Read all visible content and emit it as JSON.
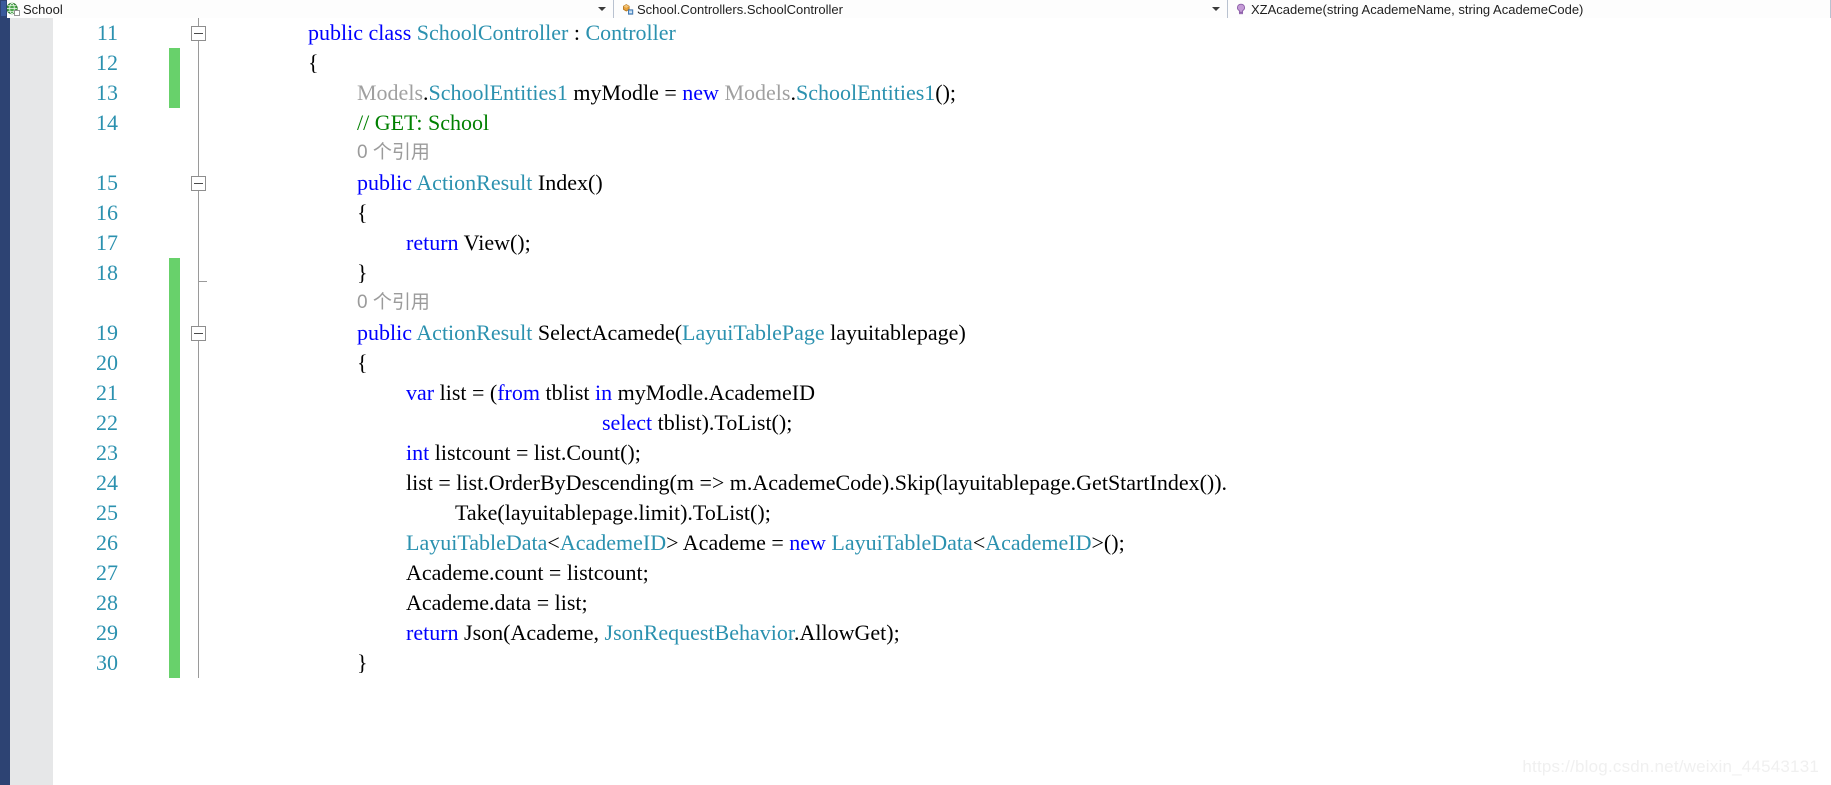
{
  "nav": {
    "project": {
      "label": "School",
      "icon": "globe-icon"
    },
    "type": {
      "label": "School.Controllers.SchoolController",
      "icon": "class-icon"
    },
    "member": {
      "label": "XZAcademe(string AcademeName, string AcademeCode)",
      "icon": "method-icon"
    },
    "dropdown_arrow": "chevron-down-icon"
  },
  "editor": {
    "first_line_number": 11,
    "last_line_number": 30,
    "line_numbers": [
      "11",
      "12",
      "13",
      "14",
      "",
      "15",
      "16",
      "17",
      "18",
      "",
      "19",
      "20",
      "21",
      "22",
      "23",
      "24",
      "25",
      "26",
      "27",
      "28",
      "29",
      "30"
    ],
    "change_bar_color": "#68d16b",
    "line_number_color": "#2b91af",
    "colors": {
      "keyword": "#0000ff",
      "type": "#2b91af",
      "comment": "#008000",
      "codelens": "#9b9b9b",
      "plain": "#000000",
      "dimmed": "#a0a0a0",
      "background": "#ffffff",
      "glyph_margin": "#e6e7e8",
      "selection_margin": "#2d4373"
    },
    "lines": [
      {
        "n": "11",
        "indent": 2,
        "change": false,
        "outline": "collapse",
        "tokens": [
          {
            "t": "public",
            "c": "kw"
          },
          {
            "t": " ",
            "c": "plain"
          },
          {
            "t": "class",
            "c": "kw"
          },
          {
            "t": " ",
            "c": "plain"
          },
          {
            "t": "SchoolController",
            "c": "typ"
          },
          {
            "t": " : ",
            "c": "plain"
          },
          {
            "t": "Controller",
            "c": "typ"
          }
        ]
      },
      {
        "n": "12",
        "indent": 2,
        "change": true,
        "outline": "line",
        "tokens": [
          {
            "t": "{",
            "c": "plain"
          }
        ]
      },
      {
        "n": "13",
        "indent": 3,
        "change": true,
        "outline": "line",
        "tokens": [
          {
            "t": "Models",
            "c": "dim"
          },
          {
            "t": ".",
            "c": "plain"
          },
          {
            "t": "SchoolEntities1",
            "c": "typ"
          },
          {
            "t": " myModle = ",
            "c": "plain"
          },
          {
            "t": "new",
            "c": "kw"
          },
          {
            "t": " ",
            "c": "plain"
          },
          {
            "t": "Models",
            "c": "dim"
          },
          {
            "t": ".",
            "c": "plain"
          },
          {
            "t": "SchoolEntities1",
            "c": "typ"
          },
          {
            "t": "();",
            "c": "plain"
          }
        ]
      },
      {
        "n": "14",
        "indent": 3,
        "change": false,
        "outline": "line",
        "tokens": [
          {
            "t": "// GET: School",
            "c": "cmt"
          }
        ]
      },
      {
        "n": "",
        "indent": 3,
        "change": false,
        "outline": "line",
        "lens": "0 个引用"
      },
      {
        "n": "15",
        "indent": 3,
        "change": false,
        "outline": "collapse",
        "tokens": [
          {
            "t": "public",
            "c": "kw"
          },
          {
            "t": " ",
            "c": "plain"
          },
          {
            "t": "ActionResult",
            "c": "typ"
          },
          {
            "t": " Index()",
            "c": "plain"
          }
        ]
      },
      {
        "n": "16",
        "indent": 3,
        "change": false,
        "outline": "line",
        "tokens": [
          {
            "t": "{",
            "c": "plain"
          }
        ]
      },
      {
        "n": "17",
        "indent": 4,
        "change": false,
        "outline": "line",
        "tokens": [
          {
            "t": "return",
            "c": "kw"
          },
          {
            "t": " View();",
            "c": "plain"
          }
        ]
      },
      {
        "n": "18",
        "indent": 3,
        "change": true,
        "outline": "line-end",
        "tokens": [
          {
            "t": "}",
            "c": "plain"
          }
        ]
      },
      {
        "n": "",
        "indent": 3,
        "change": true,
        "outline": "none",
        "lens": "0 个引用"
      },
      {
        "n": "19",
        "indent": 3,
        "change": true,
        "outline": "collapse",
        "tokens": [
          {
            "t": "public",
            "c": "kw"
          },
          {
            "t": " ",
            "c": "plain"
          },
          {
            "t": "ActionResult",
            "c": "typ"
          },
          {
            "t": " SelectAcamede(",
            "c": "plain"
          },
          {
            "t": "LayuiTablePage",
            "c": "typ"
          },
          {
            "t": " layuitablepage)",
            "c": "plain"
          }
        ]
      },
      {
        "n": "20",
        "indent": 3,
        "change": true,
        "outline": "line",
        "tokens": [
          {
            "t": "{",
            "c": "plain"
          }
        ]
      },
      {
        "n": "21",
        "indent": 4,
        "change": true,
        "outline": "line",
        "tokens": [
          {
            "t": "var",
            "c": "kw"
          },
          {
            "t": " list = (",
            "c": "plain"
          },
          {
            "t": "from",
            "c": "kw"
          },
          {
            "t": " tblist ",
            "c": "plain"
          },
          {
            "t": "in",
            "c": "kw"
          },
          {
            "t": " myModle.AcademeID",
            "c": "plain"
          }
        ]
      },
      {
        "n": "22",
        "indent": 4,
        "change": true,
        "outline": "line",
        "extra_indent": 4,
        "tokens": [
          {
            "t": "select",
            "c": "kw"
          },
          {
            "t": " tblist).ToList();",
            "c": "plain"
          }
        ]
      },
      {
        "n": "23",
        "indent": 4,
        "change": true,
        "outline": "line",
        "tokens": [
          {
            "t": "int",
            "c": "kw"
          },
          {
            "t": " listcount = list.Count();",
            "c": "plain"
          }
        ]
      },
      {
        "n": "24",
        "indent": 4,
        "change": true,
        "outline": "line",
        "tokens": [
          {
            "t": "list = list.OrderByDescending(m => m.AcademeCode).Skip(layuitablepage.GetStartIndex()).",
            "c": "plain"
          }
        ]
      },
      {
        "n": "25",
        "indent": 4,
        "change": true,
        "outline": "line",
        "extra_indent": 1,
        "tokens": [
          {
            "t": "Take(layuitablepage.limit).ToList();",
            "c": "plain"
          }
        ]
      },
      {
        "n": "26",
        "indent": 4,
        "change": true,
        "outline": "line",
        "tokens": [
          {
            "t": "LayuiTableData",
            "c": "typ"
          },
          {
            "t": "<",
            "c": "plain"
          },
          {
            "t": "AcademeID",
            "c": "typ"
          },
          {
            "t": "> Academe = ",
            "c": "plain"
          },
          {
            "t": "new",
            "c": "kw"
          },
          {
            "t": " ",
            "c": "plain"
          },
          {
            "t": "LayuiTableData",
            "c": "typ"
          },
          {
            "t": "<",
            "c": "plain"
          },
          {
            "t": "AcademeID",
            "c": "typ"
          },
          {
            "t": ">();",
            "c": "plain"
          }
        ]
      },
      {
        "n": "27",
        "indent": 4,
        "change": true,
        "outline": "line",
        "tokens": [
          {
            "t": "Academe.count = listcount;",
            "c": "plain"
          }
        ]
      },
      {
        "n": "28",
        "indent": 4,
        "change": true,
        "outline": "line",
        "tokens": [
          {
            "t": "Academe.data = list;",
            "c": "plain"
          }
        ]
      },
      {
        "n": "29",
        "indent": 4,
        "change": true,
        "outline": "line",
        "tokens": [
          {
            "t": "return",
            "c": "kw"
          },
          {
            "t": " Json(Academe, ",
            "c": "plain"
          },
          {
            "t": "JsonRequestBehavior",
            "c": "typ"
          },
          {
            "t": ".AllowGet);",
            "c": "plain"
          }
        ]
      },
      {
        "n": "30",
        "indent": 3,
        "change": true,
        "outline": "line",
        "tokens": [
          {
            "t": "}",
            "c": "plain"
          }
        ]
      }
    ]
  },
  "watermark": {
    "text": "https://blog.csdn.net/weixin_44543131"
  }
}
